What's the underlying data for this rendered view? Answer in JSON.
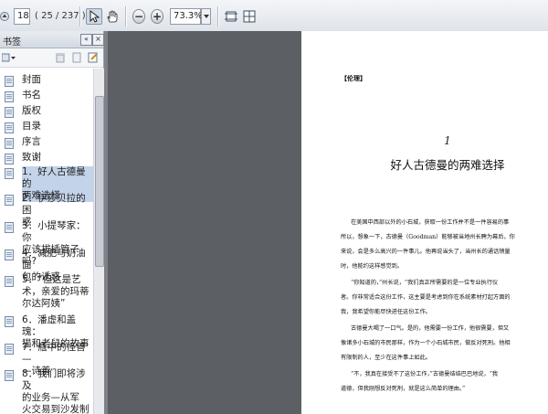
{
  "toolbar": {
    "page_current": "18",
    "page_total": "( 25 / 237 )",
    "zoom_value": "73.3%"
  },
  "panel": {
    "title": "书签",
    "bookmarks": [
      {
        "label": "封面"
      },
      {
        "label": "书名"
      },
      {
        "label": "版权"
      },
      {
        "label": "目录"
      },
      {
        "label": "序言"
      },
      {
        "label": "致谢"
      },
      {
        "label_lines": [
          "1．好人古德曼的",
          "两难选择"
        ]
      },
      {
        "label_lines": [
          "2．伊莎贝拉的困",
          "惑"
        ]
      },
      {
        "label_lines": [
          "3．小提琴家：你",
          "应该拔插管子吗?"
        ]
      },
      {
        "label_lines": [
          "4．减肥与奶油面",
          "包的诱惑"
        ]
      },
      {
        "label_lines": [
          "5．“但这是艺",
          "术，亲爱的玛蒂",
          "尔达阿姨”"
        ]
      },
      {
        "label_lines": [
          "6．潘虚和盖瑰：",
          "猫和老鼠的故事"
        ]
      },
      {
        "label_lines": [
          "7．瓶中的怪兽—",
          "—诗善"
        ]
      },
      {
        "label_lines": [
          "8．我们即将涉及",
          "的业务—从军",
          "火交易到沙发制",
          "造"
        ]
      }
    ]
  },
  "document": {
    "section_tag": "【伦理】",
    "chapter_number": "1",
    "chapter_title": "好人古德曼的两难选择",
    "lines": [
      "在美国中西部以外的小石城，获取一份工作并不是一件容易的事",
      "所以，想象一下，古德曼（Goodman）能够被当地州长聘为幕后，你",
      "来说，会是多么高兴的一件事儿。他再说当头了，当州长的通话销量",
      "时，他能约这样感觉到。",
      "“你知道的，”州长说，“我们真正所需要的是一位专业执行仪",
      "者。你非常适合这份工作，这主要是考虑到你在系统素材打起方面的",
      "我，我希望你能尽快进任这份工作。",
      "古德曼大喝了一口气。是的，他需要一份工作，他很需要，但又",
      "像诸多小石城的市民那样，作为一个小石城市民，做反对死刑。他相",
      "有限制的人，至少在这件事上如此。",
      "“不，我真在接受不了这份工作，”古德曼结结巴巴地说，“我",
      "道德，但我刚想反对死刑，就是这么简单的理由。”"
    ]
  }
}
